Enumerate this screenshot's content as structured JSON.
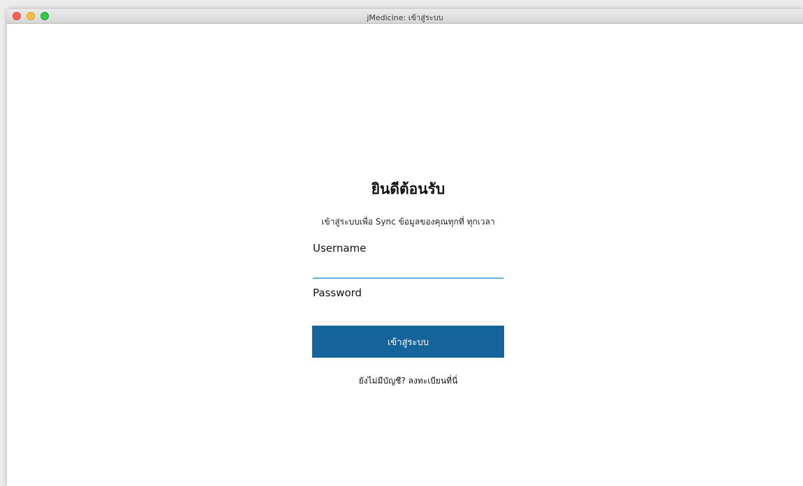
{
  "window": {
    "title": "jMedicine: เข้าสู่ระบบ"
  },
  "login": {
    "heading": "ยินดีต้อนรับ",
    "subtitle": "เข้าสู่ระบบเพื่อ Sync ข้อมูลของคุณทุกที่ ทุกเวลา",
    "username_label": "Username",
    "username_value": "",
    "password_label": "Password",
    "password_value": "",
    "submit_label": "เข้าสู่ระบบ",
    "register_link": "ยังไม่มีบัญชี? ลงทะเบียนที่นี่"
  },
  "colors": {
    "button": "#15649c",
    "focus_underline": "#5fb0de"
  }
}
